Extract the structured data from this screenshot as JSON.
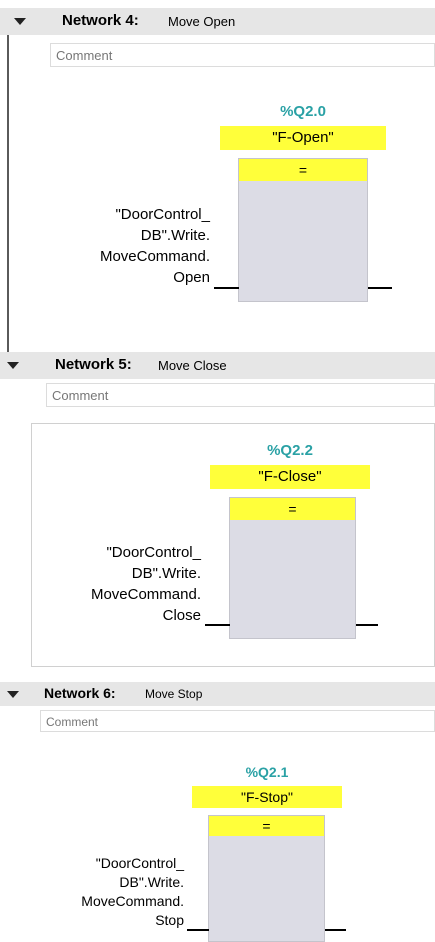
{
  "networks": [
    {
      "number": "Network 4:",
      "name": "Move Open",
      "comment_placeholder": "Comment",
      "address": "%Q2.0",
      "tag": "\"F-Open\"",
      "operator": "=",
      "operand_lines": [
        "\"DoorControl_",
        "DB\".Write.",
        "MoveCommand.",
        "Open"
      ]
    },
    {
      "number": "Network 5:",
      "name": "Move Close",
      "comment_placeholder": "Comment",
      "address": "%Q2.2",
      "tag": "\"F-Close\"",
      "operator": "=",
      "operand_lines": [
        "\"DoorControl_",
        "DB\".Write.",
        "MoveCommand.",
        "Close"
      ]
    },
    {
      "number": "Network 6:",
      "name": "Move Stop",
      "comment_placeholder": "Comment",
      "address": "%Q2.1",
      "tag": "\"F-Stop\"",
      "operator": "=",
      "operand_lines": [
        "\"DoorControl_",
        "DB\".Write.",
        "MoveCommand.",
        "Stop"
      ]
    }
  ]
}
